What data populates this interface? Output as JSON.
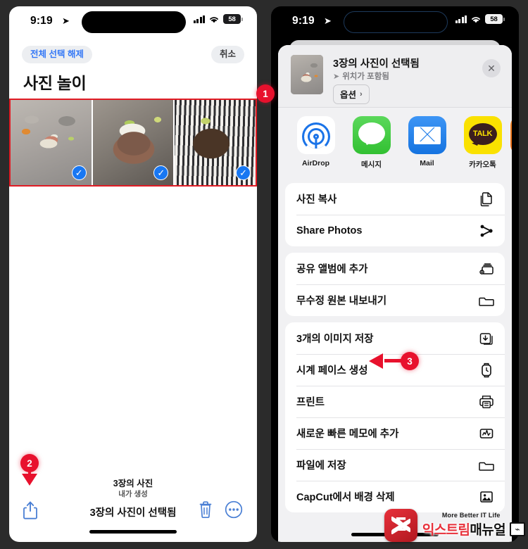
{
  "left_phone": {
    "status_bar": {
      "time": "9:19",
      "location_icon": "location-arrow-icon",
      "dynamic_island_icon": "navigation-arrow-icon",
      "cellular_icon": "cellular-bars-icon",
      "wifi_icon": "wifi-icon",
      "battery_level": "58"
    },
    "nav": {
      "deselect_all": "전체 선택 해제",
      "cancel": "취소"
    },
    "album_title": "사진 놀이",
    "photos": [
      {
        "name": "photo-thumb-1",
        "selected": true,
        "check_glyph": "✓"
      },
      {
        "name": "photo-thumb-2",
        "selected": true,
        "check_glyph": "✓"
      },
      {
        "name": "photo-thumb-3",
        "selected": true,
        "check_glyph": "✓"
      }
    ],
    "footer": {
      "count": "3장의 사진",
      "subtitle": "내가 생성",
      "selection_status": "3장의 사진이 선택됨",
      "share_icon": "share-icon",
      "trash_icon": "trash-icon",
      "more_icon": "more-ellipsis-icon"
    }
  },
  "right_phone": {
    "status_bar": {
      "time": "9:19",
      "location_icon": "location-arrow-icon",
      "dynamic_island_icon": "navigation-arrow-icon",
      "cellular_icon": "cellular-bars-icon",
      "wifi_icon": "wifi-icon",
      "battery_level": "58"
    },
    "share_sheet": {
      "title": "3장의 사진이 선택됨",
      "subtitle": "위치가 포함됨",
      "subtitle_icon": "location-arrow-icon",
      "options_button": "옵션",
      "options_chevron": "›",
      "close_glyph": "✕",
      "apps": [
        {
          "label": "AirDrop",
          "icon": "airdrop-icon"
        },
        {
          "label": "메시지",
          "icon": "messages-icon"
        },
        {
          "label": "Mail",
          "icon": "mail-icon"
        },
        {
          "label": "카카오톡",
          "icon": "kakaotalk-icon",
          "tile_text": "TALK"
        },
        {
          "label": "",
          "icon": "partial-app-icon"
        }
      ],
      "groups": [
        {
          "rows": [
            {
              "label": "사진 복사",
              "icon": "copy-documents-icon"
            },
            {
              "label": "Share Photos",
              "icon": "share-nodes-icon"
            }
          ]
        },
        {
          "rows": [
            {
              "label": "공유 앨범에 추가",
              "icon": "shared-album-icon"
            },
            {
              "label": "무수정 원본 내보내기",
              "icon": "folder-icon"
            }
          ]
        },
        {
          "rows": [
            {
              "label": "3개의 이미지 저장",
              "icon": "save-images-icon"
            },
            {
              "label": "시계 페이스 생성",
              "icon": "watch-face-icon"
            },
            {
              "label": "프린트",
              "icon": "printer-icon"
            },
            {
              "label": "새로운 빠른 메모에 추가",
              "icon": "quick-note-icon"
            },
            {
              "label": "파일에 저장",
              "icon": "folder-icon"
            },
            {
              "label": "CapCut에서 배경 삭제",
              "icon": "capcut-icon"
            }
          ]
        }
      ]
    }
  },
  "annotations": [
    {
      "number": "1",
      "target": "photo-selection-highlight"
    },
    {
      "number": "2",
      "target": "share-icon"
    },
    {
      "number": "3",
      "target": "save-images-row"
    }
  ],
  "watermark": {
    "logo_glyph": "Σ",
    "tagline": "More Better IT Life",
    "name_part1": "익스트림",
    "name_part2": "매뉴얼"
  },
  "colors": {
    "accent_blue": "#3478f6",
    "annotation_red": "#e8112d",
    "check_blue": "#1877f2",
    "highlight_border": "#e01b24",
    "brand_red": "#e8303a"
  }
}
